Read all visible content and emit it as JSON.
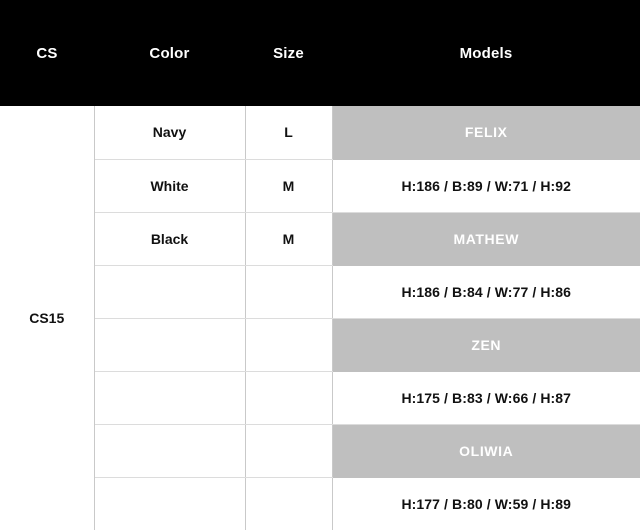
{
  "table": {
    "columns": [
      {
        "key": "cs",
        "label": "CS"
      },
      {
        "key": "color",
        "label": "Color"
      },
      {
        "key": "size",
        "label": "Size"
      },
      {
        "key": "models",
        "label": "Models"
      }
    ],
    "group_label": "CS15",
    "colors": {
      "header_background": "#000000",
      "header_text": "#ffffff",
      "band_background": "#bfbfbf",
      "band_text": "#ffffff",
      "cell_background": "#ffffff",
      "cell_text": "#111111",
      "border": "#c9c9c9"
    },
    "rows": [
      {
        "color": "Navy",
        "size": "L",
        "models": "FELIX",
        "models_kind": "band"
      },
      {
        "color": "White",
        "size": "M",
        "models": "H:186 / B:89 / W:71 / H:92",
        "models_kind": "measure"
      },
      {
        "color": "Black",
        "size": "M",
        "models": "MATHEW",
        "models_kind": "band"
      },
      {
        "color": "",
        "size": "",
        "models": "H:186 / B:84 / W:77 / H:86",
        "models_kind": "measure"
      },
      {
        "color": "",
        "size": "",
        "models": "ZEN",
        "models_kind": "band"
      },
      {
        "color": "",
        "size": "",
        "models": "H:175 / B:83 / W:66 / H:87",
        "models_kind": "measure"
      },
      {
        "color": "",
        "size": "",
        "models": "OLIWIA",
        "models_kind": "band"
      },
      {
        "color": "",
        "size": "",
        "models": "H:177 / B:80 / W:59 / H:89",
        "models_kind": "measure"
      }
    ]
  }
}
